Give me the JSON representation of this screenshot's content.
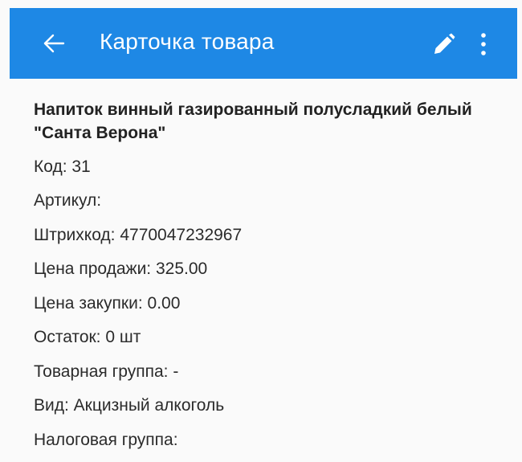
{
  "appbar": {
    "title": "Карточка товара",
    "back_icon": "arrow-left-icon",
    "edit_icon": "pencil-icon",
    "more_icon": "more-vertical-icon",
    "color": "#1e88e5"
  },
  "product": {
    "name": "Напиток винный газированный полусладкий белый \"Санта Верона\"",
    "fields": [
      "Код: 31",
      "Артикул:",
      "Штрихкод: 4770047232967",
      "Цена продажи: 325.00",
      "Цена закупки: 0.00",
      "Остаток: 0 шт",
      "Товарная группа: -",
      "Вид: Акцизный алкоголь",
      "Налоговая группа:"
    ]
  }
}
